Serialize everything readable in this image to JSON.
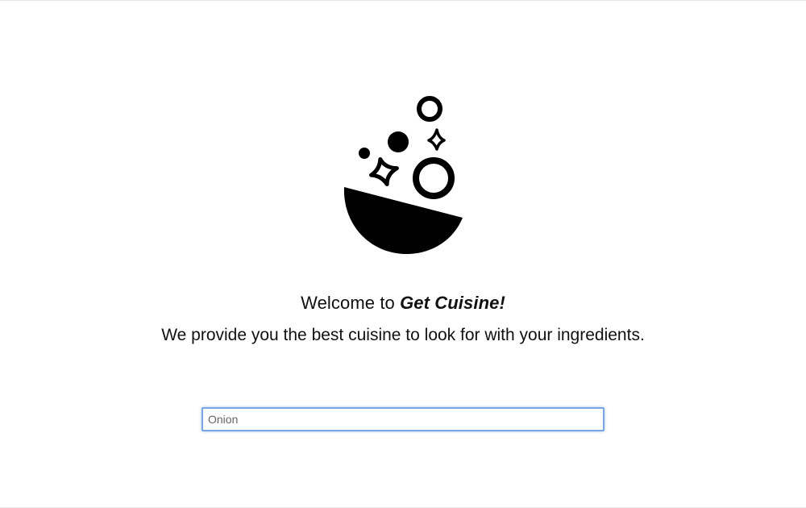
{
  "header": {
    "logo_icon": "bowl-bubbles-sparkles-icon",
    "welcome_prefix": "Welcome to ",
    "brand": "Get Cuisine!",
    "tagline": "We provide you the best cuisine to look for with your ingredients."
  },
  "search": {
    "placeholder": "Onion",
    "value": ""
  },
  "colors": {
    "text": "#111111",
    "focus_border": "#7aa6e6",
    "background": "#ffffff"
  }
}
